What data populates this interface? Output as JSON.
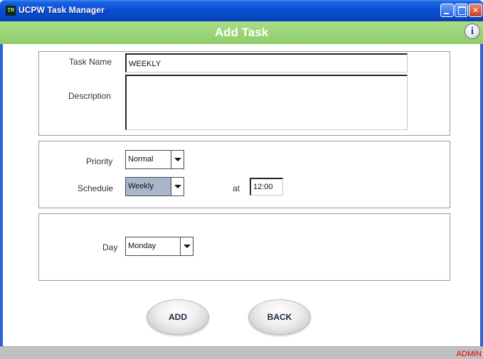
{
  "window": {
    "title": "UCPW Task Manager",
    "app_icon_glyph": "TM",
    "controls": {
      "minimize": "minimize-icon",
      "maximize": "maximize-icon",
      "close_glyph": "✕"
    }
  },
  "header": {
    "title": "Add Task",
    "info_glyph": "i",
    "color": "#9bd476"
  },
  "form": {
    "task_name_label": "Task Name",
    "task_name_value": "WEEKLY",
    "description_label": "Description",
    "description_value": "",
    "priority_label": "Priority",
    "priority_value": "Normal",
    "schedule_label": "Schedule",
    "schedule_value": "Weekly",
    "at_label": "at",
    "time_value": "12:00",
    "day_label": "Day",
    "day_value": "Monday"
  },
  "buttons": {
    "add_label": "ADD",
    "back_label": "BACK"
  },
  "status": {
    "user": "ADMIN",
    "user_color": "#e00000"
  }
}
